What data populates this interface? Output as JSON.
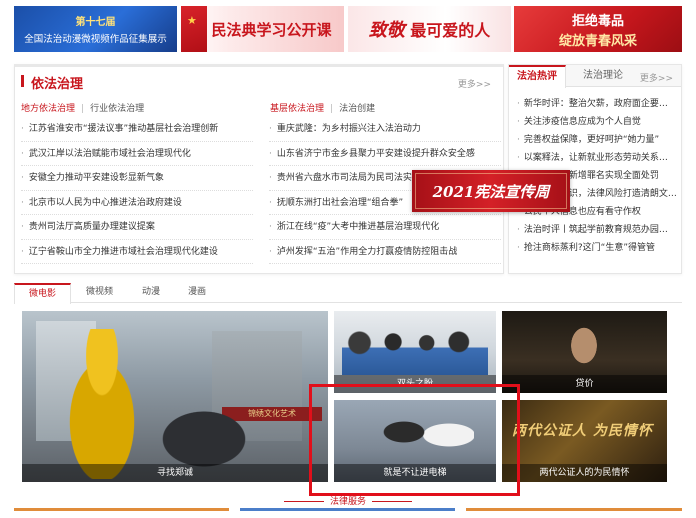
{
  "banners": [
    {
      "line1": "第十七届",
      "line2": "全国法治动漫微视频作品征集展示"
    },
    {
      "text": "民法典学习公开课"
    },
    {
      "text_a": "致敬",
      "text_b": "最可爱的人"
    },
    {
      "line1": "拒绝毒品",
      "line2": "绽放青春风采"
    }
  ],
  "left_panel": {
    "title": "依法治理",
    "more": "更多>>",
    "left_tabs": {
      "active": "地方依法治理",
      "inactive": "行业依法治理"
    },
    "right_tabs": {
      "active": "基层依法治理",
      "inactive": "法治创建"
    },
    "left_news": [
      "江苏省淮安市“援法议事”推动基层社会治理创新",
      "武汉江岸以法治赋能市域社会治理现代化",
      "安徽全力推动平安建设彰显新气象",
      "北京市以人民为中心推进法治政府建设",
      "贵州司法厅高质量办理建议提案",
      "辽宁省鞍山市全力推进市域社会治理现代化建设"
    ],
    "right_news": [
      "重庆武隆：为乡村振兴注入法治动力",
      "山东省济宁市金乡县聚力平安建设提升群众安全感",
      "贵州省六盘水市司法局为民司法实现新突破",
      "抚顺东洲打出社会治理“组合拳”",
      "浙江在线“疫”大考中推进基层治理现代化",
      "泸州发挥“五治”作用全力打赢疫情防控阻击战"
    ]
  },
  "right_panel": {
    "tab_active": "法治热评",
    "tab_inactive": "法治理论",
    "more": "更多>>",
    "items": [
      "新华时评：整治欠薪，政府面企要…",
      "关注涉疫信息应成为个人自觉",
      "完善权益保障，更好呵护“她力量”",
      "以案释法，让新就业形态劳动关系…",
      "刑法修正案新增罪名实现全面处罚",
      "风险防范意识，法律风险打造清朗文…",
      "公民个人信息也应有看守作权",
      "法治时评丨筑起学前教育规范办园…",
      "抢注商标蒸利?这门“生意”得管管"
    ]
  },
  "promo": {
    "text": "2021宪法宣传周"
  },
  "video_tabs": [
    "微电影",
    "微视频",
    "动漫",
    "漫画"
  ],
  "videos": {
    "main": {
      "caption": "寻找郑诚",
      "sign": "锦绣文化艺术"
    },
    "v1": {
      "caption": "双头之盼"
    },
    "v2": {
      "caption": "贷价"
    },
    "v3": {
      "caption": "就是不让进电梯"
    },
    "v4": {
      "caption": "两代公证人的为民情怀",
      "overlay": "两代公证人 为民情怀"
    }
  },
  "bottom": {
    "title": "法律服务"
  },
  "colors": {
    "accent": "#c8161d",
    "highlight": "#e10f1a",
    "bar_orange": "#e08c3a",
    "bar_blue": "#4b7ec9"
  }
}
